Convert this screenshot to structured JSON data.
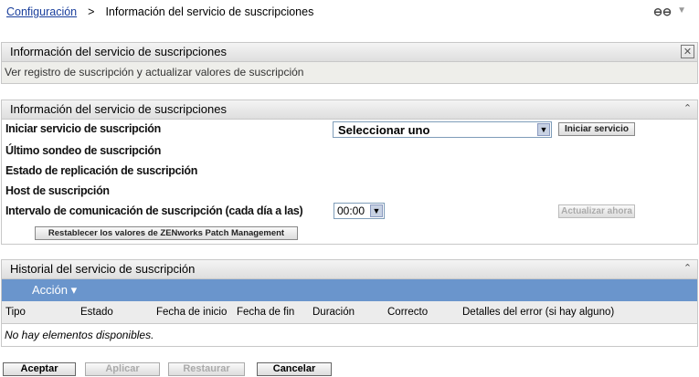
{
  "breadcrumb": {
    "parent": "Configuración",
    "separator": ">",
    "current": "Información del servicio de suscripciones"
  },
  "header_icons": {
    "link": "link-icon",
    "menu": "▼"
  },
  "info_panel": {
    "title": "Información del servicio de suscripciones",
    "description": "Ver registro de suscripción y actualizar valores de suscripción",
    "close": "✕"
  },
  "service_panel": {
    "title": "Información del servicio de suscripciones",
    "collapse": "⌃",
    "rows": [
      "Iniciar servicio de suscripción",
      "Último sondeo de suscripción",
      "Estado de replicación de suscripción",
      "Host de suscripción",
      "Intervalo de comunicación de suscripción (cada día a las)"
    ],
    "service_select": "Seleccionar uno",
    "start_button": "Iniciar servicio",
    "interval_select": "00:00",
    "update_button": "Actualizar ahora",
    "reset_button": "Restablecer los valores de ZENworks Patch Management"
  },
  "history_panel": {
    "title": "Historial del servicio de suscripción",
    "action": "Acción ▾",
    "columns": [
      "Tipo",
      "Estado",
      "Fecha de inicio",
      "Fecha de fin",
      "Duración",
      "Correcto",
      "Detalles del error (si hay alguno)"
    ],
    "empty": "No hay elementos disponibles."
  },
  "footer": {
    "ok": "Aceptar",
    "apply": "Aplicar",
    "restore": "Restaurar",
    "cancel": "Cancelar"
  }
}
